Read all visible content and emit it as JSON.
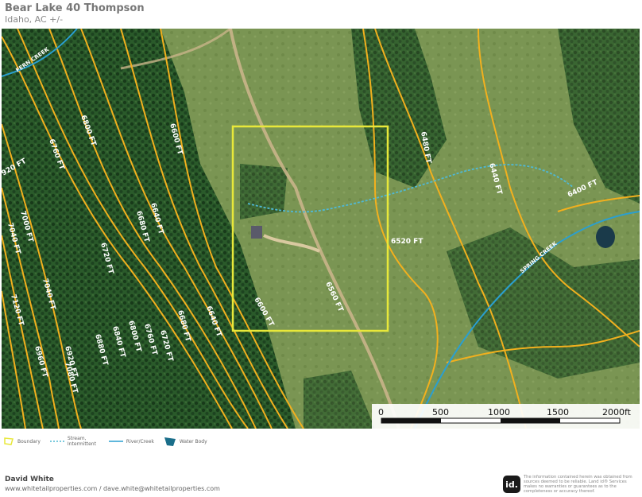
{
  "header": {
    "title": "Bear Lake 40 Thompson",
    "subtitle": "Idaho,  AC +/-"
  },
  "contours": [
    "6600 FT",
    "6640 FT",
    "6680 FT",
    "6720 FT",
    "6760 FT",
    "6800 FT",
    "6840 FT",
    "6880 FT",
    "6920 FT",
    "6960 FT",
    "7000 FT",
    "7040 FT",
    "7080 FT",
    "7120 FT",
    "6560 FT",
    "6520 FT",
    "6480 FT",
    "6440 FT",
    "6400 FT",
    "920 FT",
    "7040 FT",
    "6800 FT",
    "6760 FT",
    "6720 FT",
    "6680 FT",
    "6640 FT",
    "6600 FT"
  ],
  "creeks": {
    "fern": "FERN CREEK",
    "spring": "SPRING CREEK"
  },
  "scale": {
    "labels": [
      "0",
      "500",
      "1000",
      "1500",
      "2000ft"
    ]
  },
  "legend": {
    "boundary": "Boundary",
    "stream": "Stream, Intermittent",
    "river": "River/Creek",
    "water": "Water Body"
  },
  "footer": {
    "agent_name": "David White",
    "contact": "www.whitetailproperties.com / dave.white@whitetailproperties.com",
    "logo": "id.",
    "disclaimer": "The information contained herein was obtained from sources deemed to be reliable. Land id® Services makes no warranties or guarantees as to the completeness or accuracy thereof."
  },
  "colors": {
    "contour": "#f2b01e",
    "boundary": "#e8e83a",
    "stream": "#4fb8d4",
    "river": "#2a9fd0",
    "forest": "#1f4a22",
    "meadow": "#6f8f4b"
  }
}
